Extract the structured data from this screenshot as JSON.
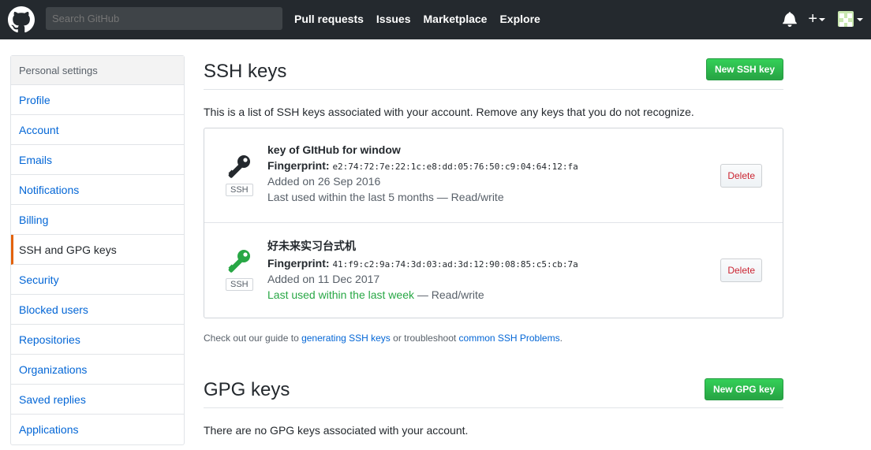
{
  "header": {
    "search_placeholder": "Search GitHub",
    "nav": [
      "Pull requests",
      "Issues",
      "Marketplace",
      "Explore"
    ],
    "plus_label": "+"
  },
  "sidebar": {
    "heading": "Personal settings",
    "items": [
      {
        "label": "Profile"
      },
      {
        "label": "Account"
      },
      {
        "label": "Emails"
      },
      {
        "label": "Notifications"
      },
      {
        "label": "Billing"
      },
      {
        "label": "SSH and GPG keys",
        "active": true
      },
      {
        "label": "Security"
      },
      {
        "label": "Blocked users"
      },
      {
        "label": "Repositories"
      },
      {
        "label": "Organizations"
      },
      {
        "label": "Saved replies"
      },
      {
        "label": "Applications"
      }
    ]
  },
  "ssh": {
    "title": "SSH keys",
    "new_button": "New SSH key",
    "description": "This is a list of SSH keys associated with your account. Remove any keys that you do not recognize.",
    "keys": [
      {
        "title": "key of GItHub for window",
        "fingerprint_label": "Fingerprint:",
        "fingerprint": "e2:74:72:7e:22:1c:e8:dd:05:76:50:c9:04:64:12:fa",
        "added": "Added on 26 Sep 2016",
        "last_used": "Last used within the last 5 months",
        "last_used_recent": "",
        "access": " — Read/write",
        "badge": "SSH",
        "delete_label": "Delete",
        "icon_color": "#24292e"
      },
      {
        "title": "好未来实习台式机",
        "fingerprint_label": "Fingerprint:",
        "fingerprint": "41:f9:c2:9a:74:3d:03:ad:3d:12:90:08:85:c5:cb:7a",
        "added": "Added on 11 Dec 2017",
        "last_used": "",
        "last_used_recent": "Last used within the last week",
        "access": " — Read/write",
        "badge": "SSH",
        "delete_label": "Delete",
        "icon_color": "#28a745"
      }
    ],
    "guide_prefix": "Check out our guide to ",
    "guide_link1": "generating SSH keys",
    "guide_middle": " or troubleshoot ",
    "guide_link2": "common SSH Problems",
    "guide_suffix": "."
  },
  "gpg": {
    "title": "GPG keys",
    "new_button": "New GPG key",
    "empty": "There are no GPG keys associated with your account."
  },
  "colors": {
    "header_bg": "#24292e",
    "link": "#0366d6",
    "green": "#28a745",
    "danger": "#cb2431",
    "active_border": "#e36209"
  }
}
